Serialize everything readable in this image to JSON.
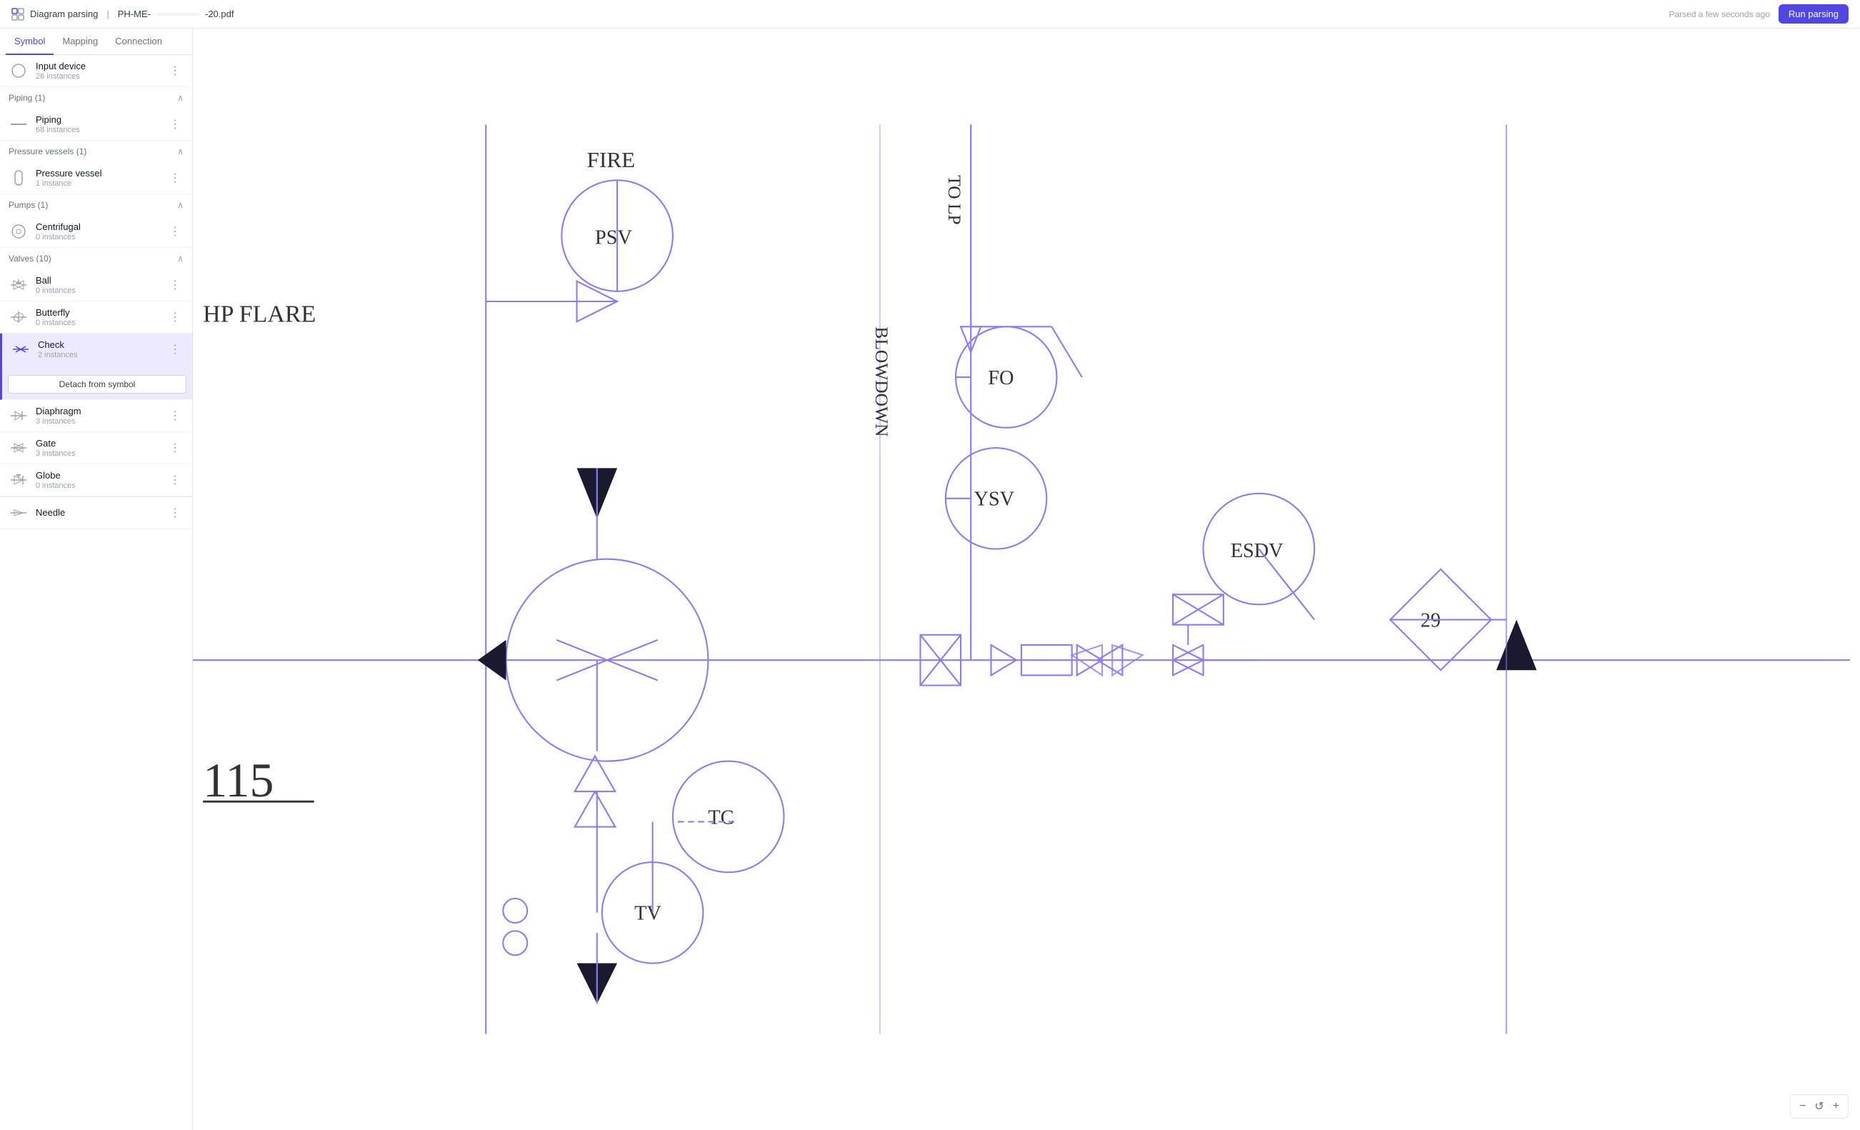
{
  "header": {
    "app_icon": "diagram-icon",
    "app_name": "Diagram parsing",
    "separator": "|",
    "filename_prefix": "PH-ME-",
    "filename_suffix": "-20.pdf",
    "parsed_text": "Parsed a few seconds ago",
    "run_button_label": "Run parsing"
  },
  "tabs": [
    {
      "id": "symbol",
      "label": "Symbol",
      "active": true
    },
    {
      "id": "mapping",
      "label": "Mapping",
      "active": false
    },
    {
      "id": "connection",
      "label": "Connection",
      "active": false
    }
  ],
  "sidebar": {
    "ungrouped": {
      "items": [
        {
          "id": "input-device",
          "name": "Input device",
          "instances": "26 instances",
          "icon": "circle-icon"
        }
      ]
    },
    "groups": [
      {
        "id": "piping",
        "label": "Piping (1)",
        "expanded": true,
        "items": [
          {
            "id": "piping",
            "name": "Piping",
            "instances": "68 instances",
            "icon": "piping-icon"
          }
        ]
      },
      {
        "id": "pressure-vessels",
        "label": "Pressure vessels (1)",
        "expanded": true,
        "items": [
          {
            "id": "pressure-vessel",
            "name": "Pressure vessel",
            "instances": "1 instance",
            "icon": "vessel-icon"
          }
        ]
      },
      {
        "id": "pumps",
        "label": "Pumps (1)",
        "expanded": true,
        "items": [
          {
            "id": "centrifugal",
            "name": "Centrifugal",
            "instances": "0 instances",
            "icon": "centrifugal-icon"
          }
        ]
      },
      {
        "id": "valves",
        "label": "Valves (10)",
        "expanded": true,
        "items": [
          {
            "id": "ball",
            "name": "Ball",
            "instances": "0 instances",
            "icon": "ball-icon"
          },
          {
            "id": "butterfly",
            "name": "Butterfly",
            "instances": "0 instances",
            "icon": "butterfly-icon"
          },
          {
            "id": "check",
            "name": "Check",
            "instances": "2 instances",
            "icon": "check-icon",
            "active": true,
            "detach_label": "Detach from symbol"
          },
          {
            "id": "diaphragm",
            "name": "Diaphragm",
            "instances": "3 instances",
            "icon": "diaphragm-icon"
          },
          {
            "id": "gate",
            "name": "Gate",
            "instances": "3 instances",
            "icon": "gate-icon"
          },
          {
            "id": "globe",
            "name": "Globe",
            "instances": "0 instances",
            "icon": "globe-icon"
          },
          {
            "id": "needle",
            "name": "Needle",
            "instances": "",
            "icon": "needle-icon"
          }
        ]
      }
    ]
  },
  "diagram": {
    "labels": {
      "fire": "FIRE",
      "psv": "PSV",
      "hp_flare": "HP  FLARE",
      "blowdown": "BLOWDOWN",
      "to_lp": "TO LP",
      "fo": "FO",
      "ysv": "YSV",
      "esdv": "ESDV",
      "tc": "TC",
      "tv": "TV",
      "number_115": "115",
      "number_29": "29"
    }
  },
  "zoom": {
    "minus_label": "−",
    "reset_label": "↺",
    "plus_label": "+"
  }
}
